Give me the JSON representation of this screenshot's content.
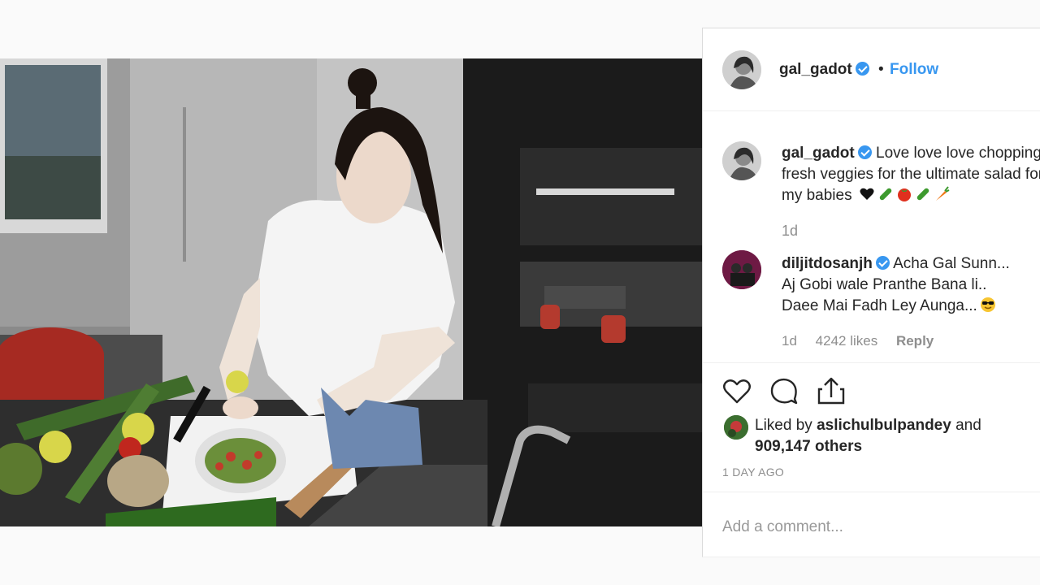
{
  "post": {
    "author": "gal_gadot",
    "separator": "•",
    "follow_label": "Follow",
    "caption_user": "gal_gadot",
    "caption_text": "Love love love chopping fresh veggies for the ultimate salad for my babies",
    "caption_emojis": [
      "black-heart",
      "cucumber",
      "tomato",
      "cucumber",
      "carrot"
    ],
    "caption_time": "1d",
    "comment": {
      "user": "diljitdosanjh",
      "line1": "Acha Gal Sunn...",
      "line2": "Aj Gobi wale Pranthe Bana li..",
      "line3": "Daee Mai Fadh Ley Aunga...",
      "emoji": "sunglasses-face",
      "time": "1d",
      "likes": "4242 likes",
      "reply": "Reply"
    },
    "liked_prefix": "Liked by",
    "liked_by": "aslichulbulpandey",
    "liked_suffix": "and",
    "liked_others": "909,147 others",
    "posted_ago": "1 DAY AGO",
    "comment_placeholder": "Add a comment..."
  },
  "icons": [
    "heart-icon",
    "comment-icon",
    "share-icon",
    "verified-badge-icon"
  ],
  "colors": {
    "link_blue": "#3897f0",
    "text": "#262626",
    "muted": "#8e8e8e",
    "border": "#efefef"
  }
}
